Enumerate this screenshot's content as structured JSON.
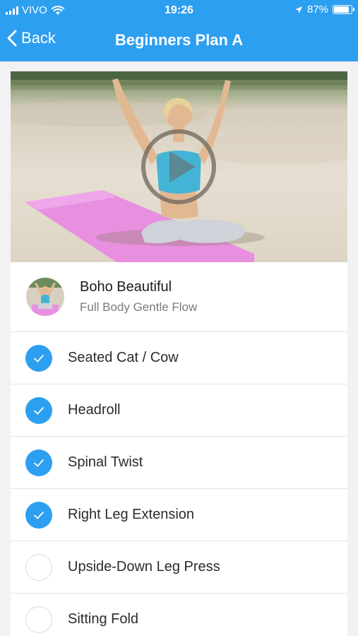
{
  "status_bar": {
    "carrier": "VIVO",
    "time": "19:26",
    "battery": "87%",
    "battery_level": 0.87
  },
  "nav": {
    "back_label": "Back",
    "title": "Beginners Plan A"
  },
  "workout": {
    "author": "Boho Beautiful",
    "subtitle": "Full Body Gentle Flow"
  },
  "exercises": [
    {
      "label": "Seated Cat / Cow",
      "done": true
    },
    {
      "label": "Headroll",
      "done": true
    },
    {
      "label": "Spinal Twist",
      "done": true
    },
    {
      "label": "Right Leg Extension",
      "done": true
    },
    {
      "label": "Upside-Down Leg Press",
      "done": false
    },
    {
      "label": "Sitting Fold",
      "done": false
    }
  ],
  "colors": {
    "accent": "#2d9ff0",
    "background": "#f2f2f4"
  }
}
